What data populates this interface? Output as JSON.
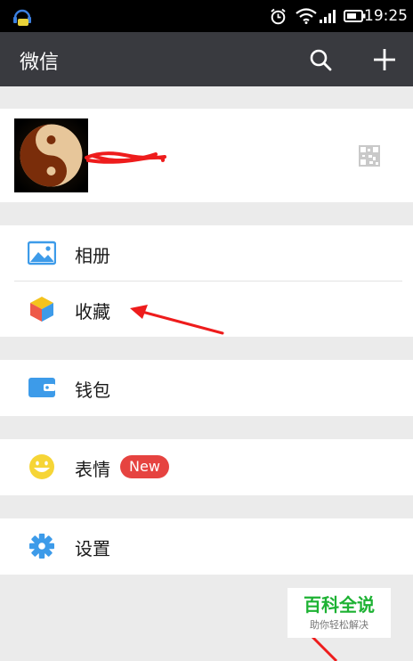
{
  "status_bar": {
    "time": "19:25"
  },
  "app_bar": {
    "title": "微信"
  },
  "menu": {
    "album": "相册",
    "favorites": "收藏",
    "wallet": "钱包",
    "stickers": "表情",
    "stickers_badge": "New",
    "settings": "设置"
  },
  "watermark": {
    "title": "百科全说",
    "subtitle": "助你轻松解决"
  },
  "colors": {
    "app_bar": "#393a3f",
    "background": "#ebebeb",
    "badge": "#e64340",
    "icon_blue": "#3d9be9",
    "annotation_arrow": "#ee1c1c"
  }
}
